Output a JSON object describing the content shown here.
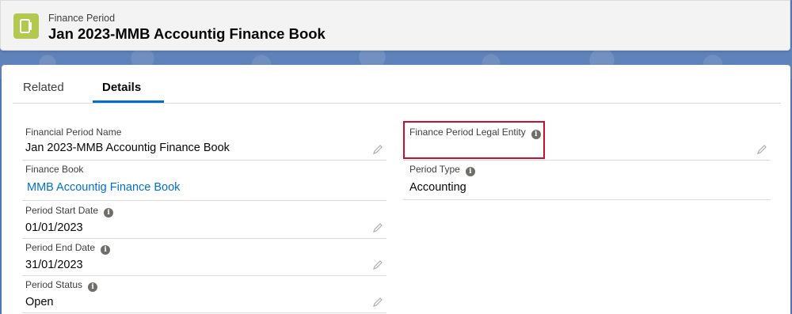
{
  "header": {
    "object_type": "Finance Period",
    "record_title": "Jan 2023-MMB Accountig Finance Book",
    "icon": "finance-period-icon"
  },
  "tabs": [
    {
      "label": "Related",
      "active": false
    },
    {
      "label": "Details",
      "active": true
    }
  ],
  "fields": {
    "financial_period_name": {
      "label": "Financial Period Name",
      "value": "Jan 2023-MMB Accountig Finance Book"
    },
    "finance_book": {
      "label": "Finance Book",
      "value": "MMB Accountig Finance Book"
    },
    "period_start_date": {
      "label": "Period Start Date",
      "value": "01/01/2023"
    },
    "period_end_date": {
      "label": "Period End Date",
      "value": "31/01/2023"
    },
    "period_status": {
      "label": "Period Status",
      "value": "Open"
    },
    "finance_period_legal_entity": {
      "label": "Finance Period Legal Entity",
      "value": ""
    },
    "period_type": {
      "label": "Period Type",
      "value": "Accounting"
    }
  },
  "colors": {
    "accent": "#0070d2",
    "icon_bg": "#b2c94f",
    "highlight": "#c8102e"
  }
}
